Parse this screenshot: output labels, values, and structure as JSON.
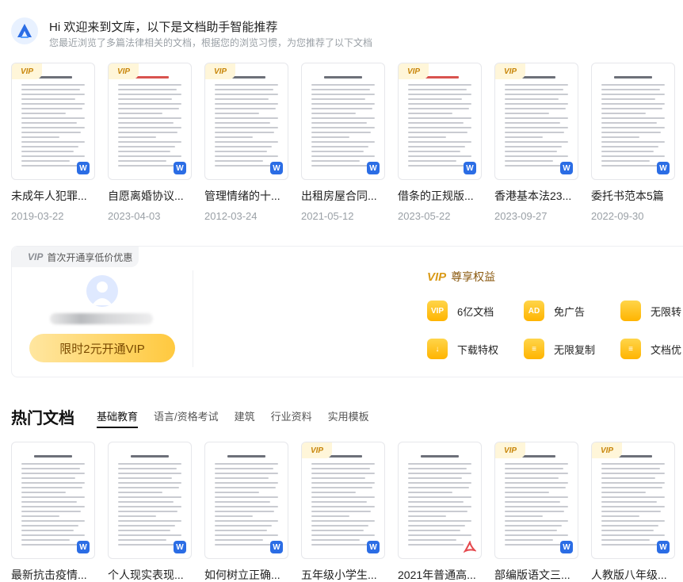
{
  "greeting": {
    "title": "Hi 欢迎来到文库，以下是文档助手智能推荐",
    "subtitle": "您最近浏览了多篇法律相关的文档，根据您的浏览习惯，为您推荐了以下文档"
  },
  "recommended": [
    {
      "title": "未成年人犯罪...",
      "date": "2019-03-22",
      "vip": true,
      "format": "word"
    },
    {
      "title": "自愿离婚协议...",
      "date": "2023-04-03",
      "vip": true,
      "format": "word"
    },
    {
      "title": "管理情绪的十...",
      "date": "2012-03-24",
      "vip": true,
      "format": "word"
    },
    {
      "title": "出租房屋合同...",
      "date": "2021-05-12",
      "vip": false,
      "format": "word"
    },
    {
      "title": "借条的正规版...",
      "date": "2023-05-22",
      "vip": true,
      "format": "word"
    },
    {
      "title": "香港基本法23...",
      "date": "2023-09-27",
      "vip": true,
      "format": "word"
    },
    {
      "title": "委托书范本5篇",
      "date": "2022-09-30",
      "vip": false,
      "format": "word"
    }
  ],
  "vip_panel": {
    "tab_label": "首次开通享低价优惠",
    "vip_mark": "VIP",
    "button_label": "限时2元开通VIP",
    "benefits_title": "尊享权益",
    "benefits": [
      {
        "label": "6亿文档",
        "icon": "vip-doc-icon",
        "glyph": "VIP"
      },
      {
        "label": "免广告",
        "icon": "ad-free-icon",
        "glyph": "AD"
      },
      {
        "label": "无限转",
        "icon": "convert-icon",
        "glyph": ""
      },
      {
        "label": "下载特权",
        "icon": "download-icon",
        "glyph": "↓"
      },
      {
        "label": "无限复制",
        "icon": "copy-icon",
        "glyph": "≡"
      },
      {
        "label": "文档优",
        "icon": "doc-optimize-icon",
        "glyph": "≡"
      }
    ]
  },
  "hot": {
    "title": "热门文档",
    "tabs": [
      "基础教育",
      "语言/资格考试",
      "建筑",
      "行业资料",
      "实用模板"
    ],
    "active_tab": 0,
    "docs": [
      {
        "title": "最新抗击疫情...",
        "vip": false,
        "format": "word"
      },
      {
        "title": "个人现实表现...",
        "vip": false,
        "format": "word"
      },
      {
        "title": "如何树立正确...",
        "vip": false,
        "format": "word"
      },
      {
        "title": "五年级小学生...",
        "vip": true,
        "format": "word"
      },
      {
        "title": "2021年普通高...",
        "vip": false,
        "format": "pdf"
      },
      {
        "title": "部编版语文三...",
        "vip": true,
        "format": "word"
      },
      {
        "title": "人教版八年级...",
        "vip": true,
        "format": "word"
      }
    ]
  },
  "colors": {
    "accent": "#2b6de5",
    "vip_gold": "#ffc93f",
    "vip_text": "#8b5a10",
    "pdf": "#e5484d"
  }
}
